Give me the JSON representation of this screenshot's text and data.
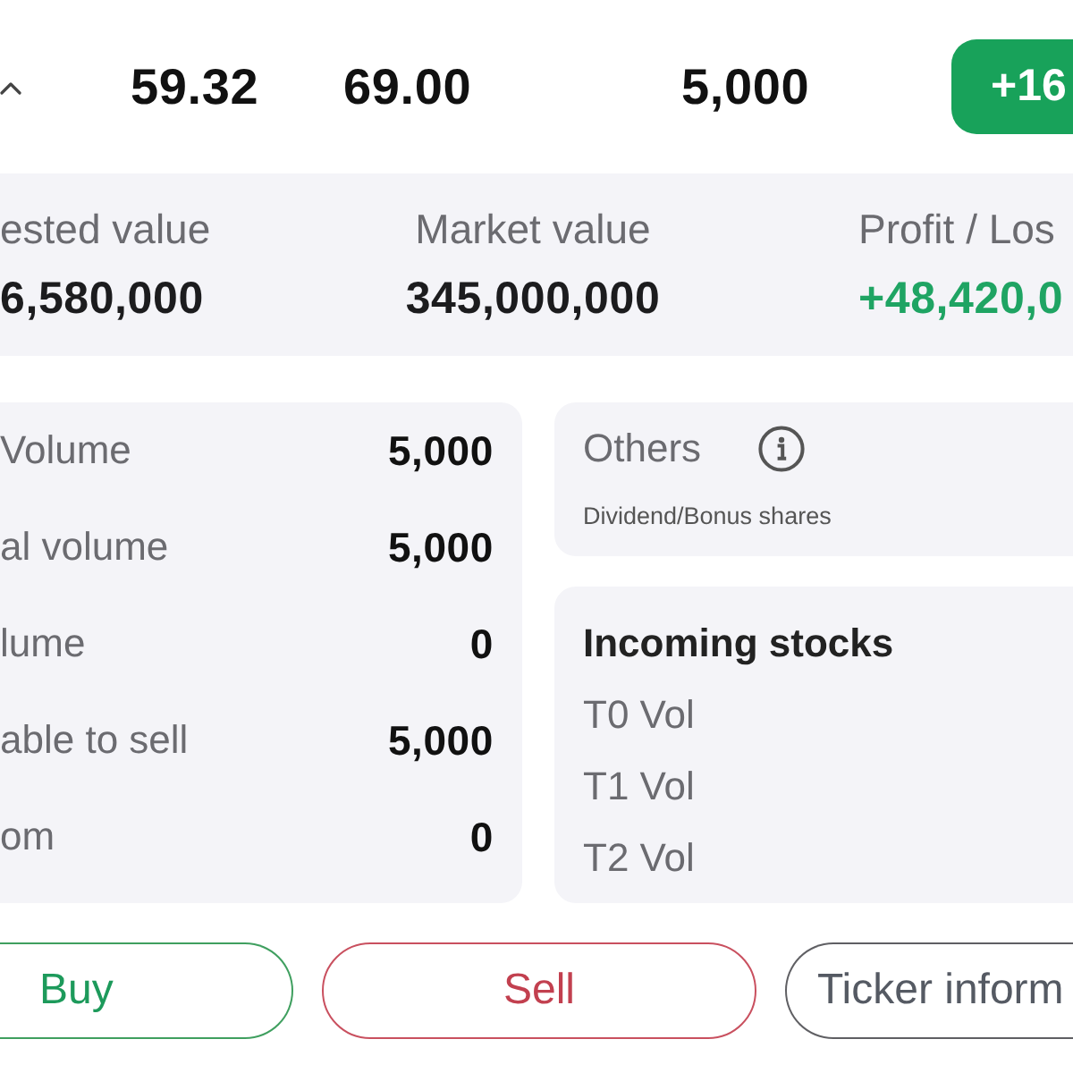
{
  "position_row": {
    "cells": [
      "59.32",
      "69.00",
      "5,000"
    ],
    "change": "+16"
  },
  "summary": [
    {
      "label": "ested value",
      "value": "6,580,000",
      "kind": "plain"
    },
    {
      "label": "Market value",
      "value": "345,000,000",
      "kind": "plain"
    },
    {
      "label": "Profit / Los",
      "value": "+48,420,0",
      "kind": "gain"
    }
  ],
  "holdings": [
    {
      "label": "Volume",
      "value": "5,000"
    },
    {
      "label": "al volume",
      "value": "5,000"
    },
    {
      "label": "lume",
      "value": "0"
    },
    {
      "label": "able to sell",
      "value": "5,000"
    },
    {
      "label": "om",
      "value": "0"
    }
  ],
  "others": {
    "title": "Others",
    "note": "Dividend/Bonus shares"
  },
  "incoming_stocks": {
    "title": "Incoming stocks",
    "rows": [
      "T0 Vol",
      "T1 Vol",
      "T2 Vol"
    ]
  },
  "actions": [
    {
      "label": "Buy",
      "kind": "buy"
    },
    {
      "label": "Sell",
      "kind": "sell"
    },
    {
      "label": "Ticker inform",
      "kind": "info"
    }
  ]
}
